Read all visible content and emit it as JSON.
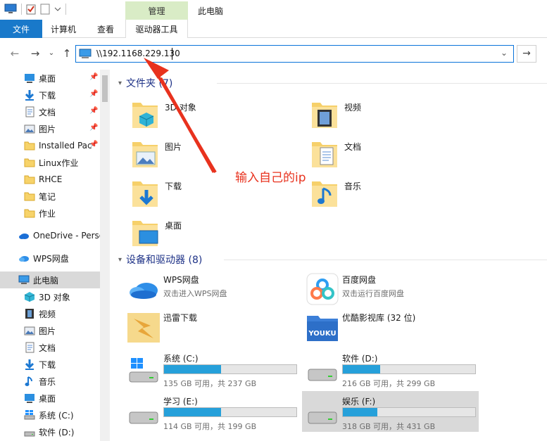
{
  "window": {
    "manage_tab": "管理",
    "title": "此电脑"
  },
  "ribbon": {
    "file": "文件",
    "computer": "计算机",
    "view": "查看",
    "drive_tools": "驱动器工具"
  },
  "address": {
    "path": "\\\\192.1168.229.130"
  },
  "sidebar": {
    "quick": [
      {
        "label": "桌面",
        "icon": "desktop-icon",
        "pinned": true
      },
      {
        "label": "下载",
        "icon": "download-icon",
        "pinned": true
      },
      {
        "label": "文档",
        "icon": "document-icon",
        "pinned": true
      },
      {
        "label": "图片",
        "icon": "picture-icon",
        "pinned": true
      },
      {
        "label": "Installed Pac",
        "icon": "folder-icon",
        "pinned": true
      },
      {
        "label": "Linux作业",
        "icon": "folder-icon",
        "pinned": false
      },
      {
        "label": "RHCE",
        "icon": "folder-icon",
        "pinned": false
      },
      {
        "label": "笔记",
        "icon": "folder-icon",
        "pinned": false
      },
      {
        "label": "作业",
        "icon": "folder-icon",
        "pinned": false
      }
    ],
    "onedrive": "OneDrive - Perso",
    "wps": "WPS网盘",
    "thispc": "此电脑",
    "pc_items": [
      {
        "label": "3D 对象",
        "icon": "cube-icon"
      },
      {
        "label": "视频",
        "icon": "video-icon"
      },
      {
        "label": "图片",
        "icon": "picture-icon"
      },
      {
        "label": "文档",
        "icon": "document-icon"
      },
      {
        "label": "下载",
        "icon": "download-icon"
      },
      {
        "label": "音乐",
        "icon": "music-icon"
      },
      {
        "label": "桌面",
        "icon": "desktop-icon"
      },
      {
        "label": "系统 (C:)",
        "icon": "windows-drive-icon"
      },
      {
        "label": "软件 (D:)",
        "icon": "drive-icon"
      }
    ]
  },
  "main": {
    "folders_header": "文件夹 (7)",
    "folders": [
      {
        "label": "3D 对象",
        "icon": "cube-folder-icon"
      },
      {
        "label": "视频",
        "icon": "video-folder-icon"
      },
      {
        "label": "图片",
        "icon": "picture-folder-icon"
      },
      {
        "label": "文档",
        "icon": "document-folder-icon"
      },
      {
        "label": "下载",
        "icon": "download-folder-icon"
      },
      {
        "label": "音乐",
        "icon": "music-folder-icon"
      },
      {
        "label": "桌面",
        "icon": "desktop-folder-icon"
      }
    ],
    "devices_header": "设备和驱动器 (8)",
    "apps": [
      {
        "name": "WPS网盘",
        "sub": "双击进入WPS网盘",
        "icon": "wps-cloud-icon"
      },
      {
        "name": "百度网盘",
        "sub": "双击运行百度网盘",
        "icon": "baidu-netdisk-icon"
      },
      {
        "name": "迅雷下载",
        "sub": "",
        "icon": "xunlei-icon"
      },
      {
        "name": "优酷影视库 (32 位)",
        "sub": "",
        "icon": "youku-icon"
      }
    ],
    "drives": [
      {
        "name": "系统 (C:)",
        "free": "135 GB 可用，共 237 GB",
        "used_fraction": 0.43,
        "icon": "windows-drive-icon"
      },
      {
        "name": "软件 (D:)",
        "free": "216 GB 可用，共 299 GB",
        "used_fraction": 0.28,
        "icon": "drive-icon"
      },
      {
        "name": "学习 (E:)",
        "free": "114 GB 可用，共 199 GB",
        "used_fraction": 0.43,
        "icon": "drive-icon"
      },
      {
        "name": "娱乐 (F:)",
        "free": "318 GB 可用，共 431 GB",
        "used_fraction": 0.26,
        "icon": "drive-icon"
      }
    ],
    "youku_text": "YOUKU"
  },
  "annotation": {
    "text": "输入自己的ip"
  },
  "colors": {
    "accent": "#1979ca",
    "manage_tab": "#d9ecc6",
    "bar_fill": "#26a0da",
    "annotation": "#e8321e"
  }
}
